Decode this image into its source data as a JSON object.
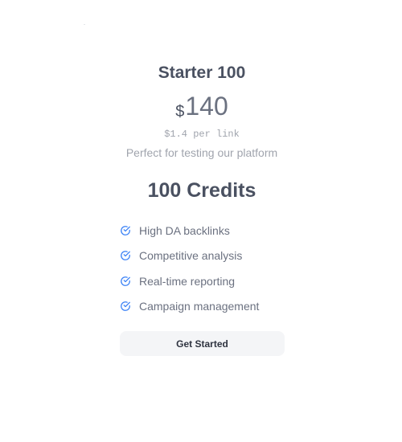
{
  "plan": {
    "name": "Starter 100",
    "currency_symbol": "$",
    "price": "140",
    "per_link": "$1.4 per link",
    "tagline": "Perfect for testing our platform",
    "credits": "100 Credits"
  },
  "features": [
    {
      "label": "High DA backlinks",
      "icon": "check-circle-icon"
    },
    {
      "label": "Competitive analysis",
      "icon": "check-circle-icon"
    },
    {
      "label": "Real-time reporting",
      "icon": "check-circle-icon"
    },
    {
      "label": "Campaign management",
      "icon": "check-circle-icon"
    }
  ],
  "cta": {
    "label": "Get Started"
  },
  "colors": {
    "check_icon": "#3b82f6",
    "heading": "#4a5161",
    "muted": "#a0a4ad",
    "button_bg": "#f4f5f7"
  }
}
